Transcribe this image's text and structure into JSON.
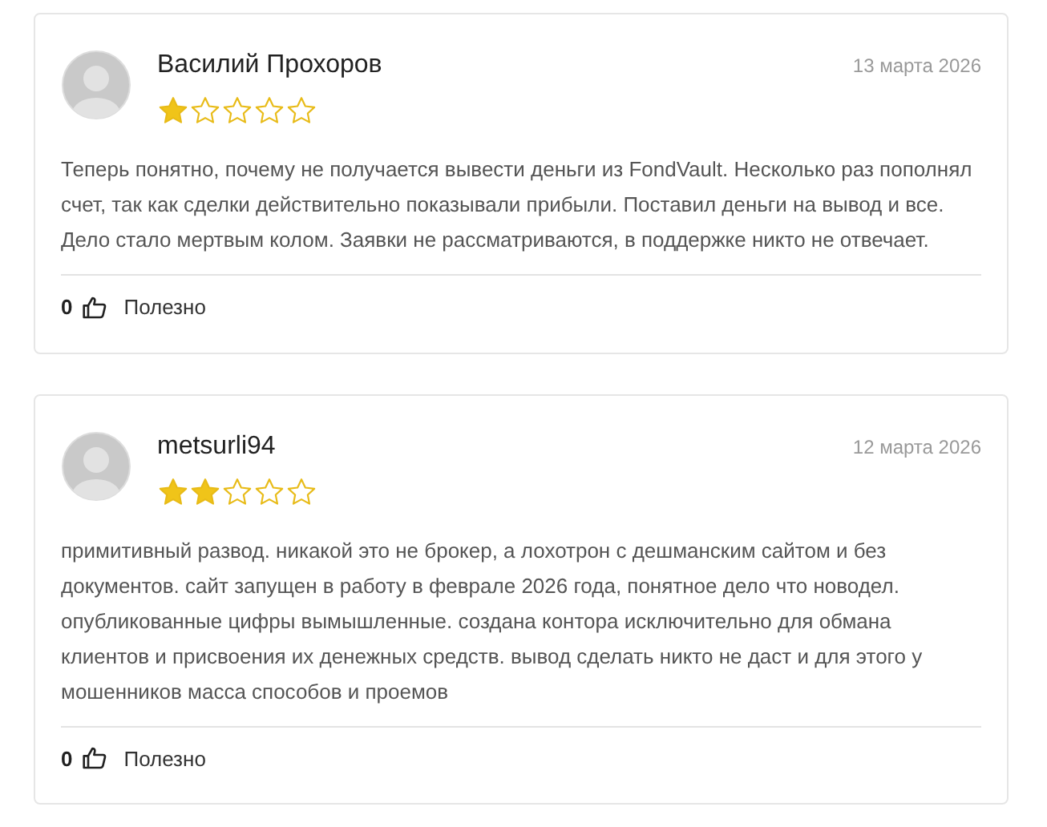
{
  "reviews": [
    {
      "author": "Василий Прохоров",
      "date": "13 марта 2026",
      "stars": 1,
      "text": "Теперь понятно, почему не получается вывести деньги из FondVault. Несколько раз пополнял счет, так как сделки действительно показывали прибыли. Поставил деньги на вывод и все. Дело стало мертвым колом. Заявки не рассматриваются, в поддержке никто не отвечает.",
      "likes": "0",
      "helpful_label": "Полезно"
    },
    {
      "author": "metsurli94",
      "date": "12 марта 2026",
      "stars": 2,
      "text": "примитивный развод. никакой это не брокер, а лохотрон с дешманским сайтом и без документов. сайт запущен в работу в феврале 2026 года, понятное дело что новодел. опубликованные цифры вымышленные. создана контора исключительно для обмана клиентов и присвоения их денежных средств. вывод сделать никто не даст и для этого у мошенников масса способов и проемов",
      "likes": "0",
      "helpful_label": "Полезно"
    }
  ]
}
